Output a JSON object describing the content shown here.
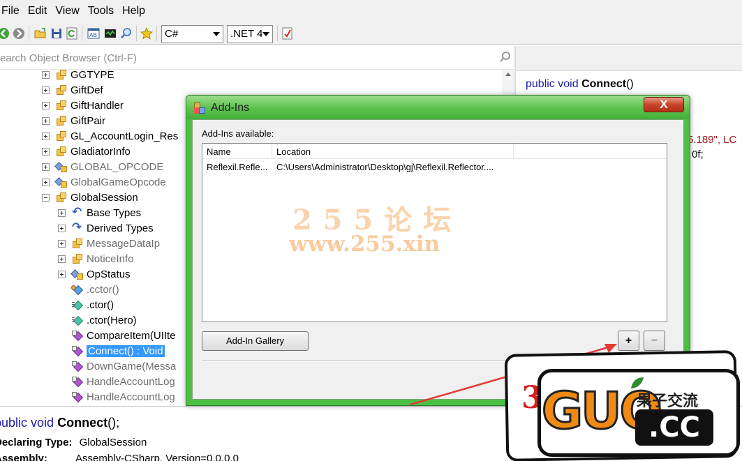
{
  "menu": [
    "File",
    "Edit",
    "View",
    "Tools",
    "Help"
  ],
  "toolbar": {
    "language": "C#",
    "framework": ".NET 4"
  },
  "tree": {
    "search_placeholder": "earch Object Browser (Ctrl-F)",
    "items": [
      {
        "label": "GGTYPE",
        "icon": "class-icon",
        "expander": "plus",
        "muted": false
      },
      {
        "label": "GiftDef",
        "icon": "class-icon",
        "expander": "plus",
        "muted": false
      },
      {
        "label": "GiftHandler",
        "icon": "class-icon",
        "expander": "plus",
        "muted": false
      },
      {
        "label": "GiftPair",
        "icon": "class-icon",
        "expander": "plus",
        "muted": false
      },
      {
        "label": "GL_AccountLogin_Res",
        "icon": "class-icon",
        "expander": "plus",
        "muted": false
      },
      {
        "label": "GladiatorInfo",
        "icon": "class-icon",
        "expander": "plus",
        "muted": false
      },
      {
        "label": "GLOBAL_OPCODE",
        "icon": "enum-icon",
        "expander": "plus",
        "muted": true
      },
      {
        "label": "GlobalGameOpcode",
        "icon": "enum-icon",
        "expander": "plus",
        "muted": true
      },
      {
        "label": "GlobalSession",
        "icon": "class-icon",
        "expander": "minus",
        "muted": false
      },
      {
        "label": "Base Types",
        "icon": "base-types-icon",
        "expander": "plus",
        "muted": false
      },
      {
        "label": "Derived Types",
        "icon": "derived-types-icon",
        "expander": "plus",
        "muted": false
      },
      {
        "label": "MessageDataIp",
        "icon": "class-icon",
        "expander": "plus",
        "muted": true
      },
      {
        "label": "NoticeInfo",
        "icon": "class-icon",
        "expander": "plus",
        "muted": true
      },
      {
        "label": "OpStatus",
        "icon": "enum-icon",
        "expander": "plus",
        "muted": false
      },
      {
        "label": ".cctor()",
        "icon": "static-ctor-icon",
        "expander": "none",
        "muted": true
      },
      {
        "label": ".ctor()",
        "icon": "ctor-icon",
        "expander": "none",
        "muted": false
      },
      {
        "label": ".ctor(Hero)",
        "icon": "ctor-icon",
        "expander": "none",
        "muted": false
      },
      {
        "label": "CompareItem(UIIte",
        "icon": "method-icon",
        "expander": "none",
        "muted": false
      },
      {
        "label": "Connect() : Void",
        "icon": "method-icon",
        "expander": "none",
        "muted": false,
        "selected": true
      },
      {
        "label": "DownGame(Messa",
        "icon": "method-icon",
        "expander": "none",
        "muted": true
      },
      {
        "label": "HandleAccountLog",
        "icon": "method-icon",
        "expander": "none",
        "muted": true
      },
      {
        "label": "HandleAccountLog",
        "icon": "method-icon",
        "expander": "none",
        "muted": true
      }
    ]
  },
  "code": {
    "public": "public",
    "void": "void",
    "method": "Connect",
    "parens": "()",
    "str_fragment": "5.189\", LC",
    "num_fragment": "0f;"
  },
  "description": {
    "public": "public",
    "void": "void",
    "method": "Connect",
    "rest": "();",
    "declaring_label": "Declaring Type:",
    "declaring_value": "GlobalSession",
    "assembly_label": "Assembly:",
    "assembly_value": "Assembly-CSharp, Version=0.0.0.0"
  },
  "dialog": {
    "title": "Add-Ins",
    "available_label": "Add-Ins available:",
    "columns": [
      "Name",
      "Location"
    ],
    "rows": [
      {
        "name": "Reflexil.Refle...",
        "location": "C:\\Users\\Administrator\\Desktop\\gj\\Reflexil.Reflector...."
      }
    ],
    "gallery_button": "Add-In Gallery",
    "add_button": "+",
    "remove_button": "−",
    "close_button": "X"
  },
  "watermark": {
    "line1": "2 5 5 论 坛",
    "line2": "www.255.xin"
  },
  "logo": {
    "text": "GUO",
    "tld": ".CC",
    "chinese": "果子交流",
    "digit": "3"
  },
  "colors": {
    "dialog_frame": "#4bc043",
    "selection": "#3399ff",
    "keyword": "#1a1aa6",
    "arrow": "#e53935"
  }
}
